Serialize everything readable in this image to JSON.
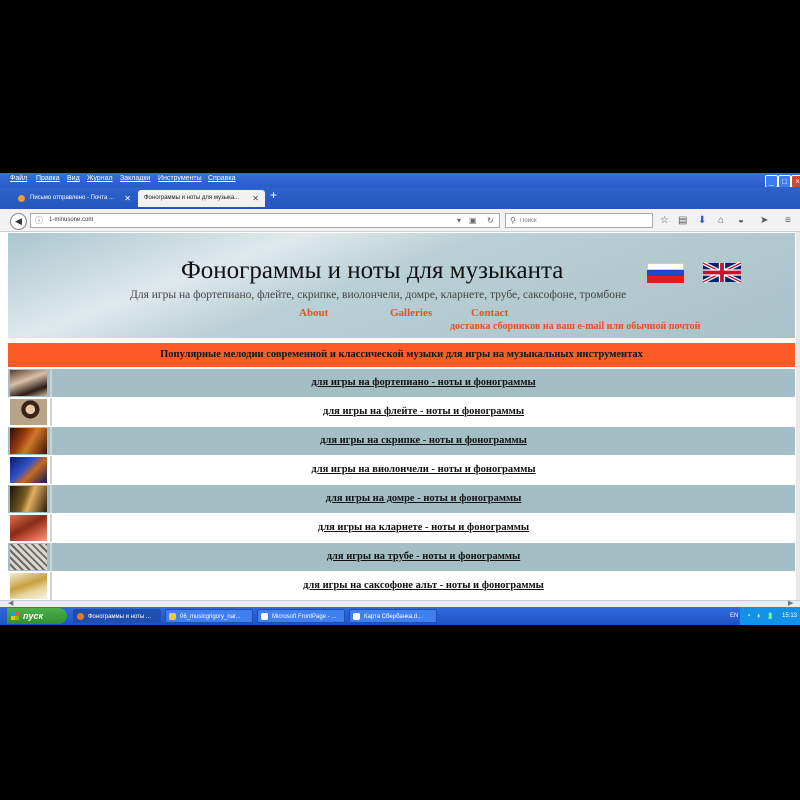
{
  "browser": {
    "menu": [
      "Файл",
      "Правка",
      "Вид",
      "Журнал",
      "Закладки",
      "Инструменты",
      "Справка"
    ],
    "tabs": [
      {
        "label": "Письмо отправлено - Почта ...",
        "active": false
      },
      {
        "label": "Фонограммы и ноты для музыка...",
        "active": true
      }
    ],
    "url": "1-minusone.com",
    "search_placeholder": "Поиск"
  },
  "page": {
    "title": "Фонограммы и ноты для музыканта",
    "subtitle": "Для игры на фортепиано, флейте, скрипке, виолончели, домре, кларнете, трубе, саксофоне, тромбоне",
    "nav": {
      "about": "About",
      "galleries": "Galleries",
      "contact": "Contact"
    },
    "delivery_note": "доставка сборников на ваш e-mail или обычной почтой",
    "banner": "Популярные мелодии современной и классической музыки для игры на музыкальных инструментах",
    "rows": [
      {
        "label": "для игры на фортепиано - ноты и фонограммы",
        "bg": "#a3bfc5"
      },
      {
        "label": "для игры на флейте - ноты и фонограммы",
        "bg": "#ffffff"
      },
      {
        "label": "для игры на скрипке - ноты и фонограммы",
        "bg": "#a3bfc5"
      },
      {
        "label": "для игры на виолончели - ноты и фонограммы",
        "bg": "#ffffff"
      },
      {
        "label": "для игры на домре - ноты и фонограммы",
        "bg": "#a3bfc5"
      },
      {
        "label": "для игры на кларнете - ноты и фонограммы",
        "bg": "#ffffff"
      },
      {
        "label": "для игры на  трубе - ноты и фонограммы",
        "bg": "#a3bfc5"
      },
      {
        "label": "для игры на саксофоне альт - ноты и фонограммы",
        "bg": "#ffffff"
      }
    ]
  },
  "taskbar": {
    "start": "пуск",
    "tasks": [
      "Фонограммы и ноты ...",
      "06_musicgrigory_nar...",
      "Microsoft FrontPage - ...",
      "Карта Сбербанка.d..."
    ],
    "lang": "EN",
    "clock": "15:13"
  },
  "colors": {
    "accent": "#ff5a28",
    "link_orange": "#e55020",
    "row_alt": "#a3bfc5"
  }
}
